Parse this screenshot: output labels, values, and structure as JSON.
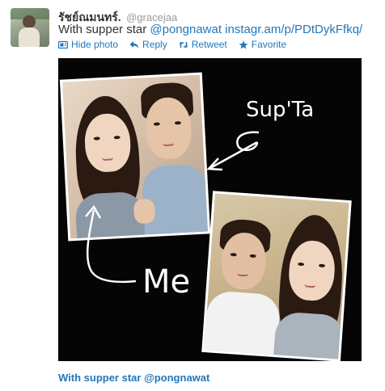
{
  "tweet": {
    "display_name": "รัชย์ณมนทร์.",
    "handle": "@gracejaa",
    "text": "With supper star ",
    "mention_link": "@pongnawat",
    "url_link": " instagr.am/p/PDtDykFfkq/",
    "avatar_icon": "user-avatar-photo"
  },
  "actions": [
    {
      "label": "Hide photo",
      "icon": "photo-icon"
    },
    {
      "label": "Reply",
      "icon": "reply-icon"
    },
    {
      "label": "Retweet",
      "icon": "retweet-icon"
    },
    {
      "label": "Favorite",
      "icon": "star-icon"
    }
  ],
  "photo": {
    "annotation_top": "Sup'Ta",
    "annotation_bottom": "Me"
  },
  "caption": "With supper star @pongnawat",
  "colors": {
    "link": "#2277bb",
    "photo_background": "#050505",
    "annotation": "#ffffff"
  }
}
